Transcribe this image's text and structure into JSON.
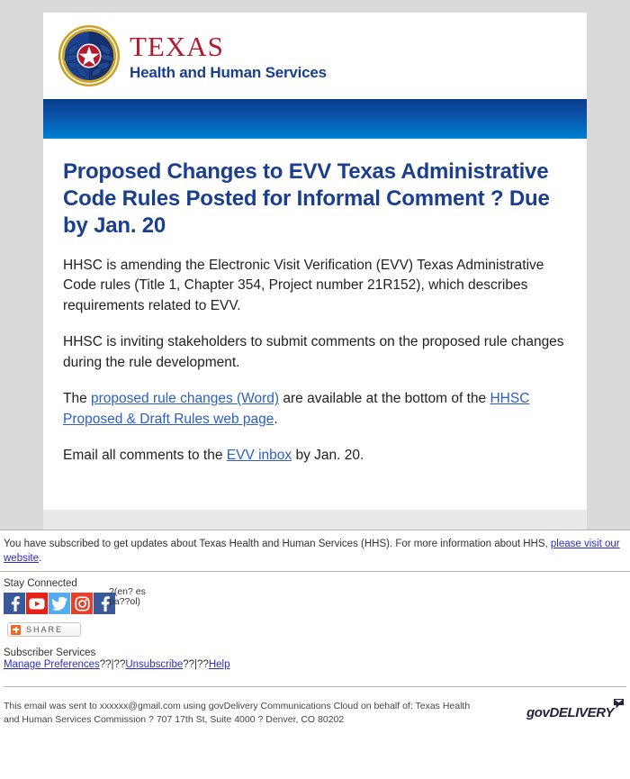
{
  "brand": {
    "seal_icon": "texas-state-seal-icon",
    "name_primary": "TEXAS",
    "name_secondary": "Health and Human Services"
  },
  "email": {
    "title": "Proposed Changes to EVV Texas Administrative Code Rules Posted for Informal Comment ? Due by Jan. 20",
    "paragraph_1": "HHSC is amending the Electronic Visit Verification (EVV) Texas Administrative Code rules (Title 1, Chapter 354, Project number 21R152), which describes requirements related to EVV.",
    "paragraph_2": "HHSC is inviting stakeholders to submit comments on the proposed rule changes during the rule development.",
    "paragraph_3": {
      "lead": "The ",
      "link_1": "proposed rule changes (Word)",
      "middle": " are available at the bottom of the ",
      "link_2": "HHSC Proposed & Draft Rules web page",
      "tail": "."
    },
    "paragraph_4": {
      "lead": "Email all comments to the ",
      "link_1": "EVV inbox",
      "tail": " by Jan. 20."
    }
  },
  "subscription": {
    "notice_lead": "You have subscribed to get updates about Texas Health and Human Services (HHS). For more information about HHS, ",
    "notice_link": "please visit our website",
    "notice_tail": "."
  },
  "stay_connected": {
    "label": "Stay Connected",
    "social": [
      {
        "name": "facebook-icon",
        "platform": "Facebook"
      },
      {
        "name": "youtube-icon",
        "platform": "YouTube"
      },
      {
        "name": "twitter-icon",
        "platform": "Twitter"
      },
      {
        "name": "instagram-icon",
        "platform": "Instagram"
      },
      {
        "name": "facebook-spanish-icon",
        "platform": "Facebook"
      }
    ],
    "language_note": "?(en? espa??ol)",
    "share_button": {
      "label": "SHARE",
      "icon": "share-plus-icon"
    }
  },
  "subscriber_services": {
    "label": "Subscriber Services",
    "link_manage": "Manage Preferences",
    "sep_1": "??|??",
    "link_unsubscribe": "Unsubscribe",
    "sep_2": "??|??",
    "link_help": "Help"
  },
  "legal": {
    "text": "This email was sent to xxxxxx@gmail.com using govDelivery Communications Cloud on behalf of: Texas Health and Human Services Commission ? 707 17th St, Suite 4000 ? Denver, CO 80202",
    "provider_logo": "govDELIVERY",
    "provider_mark": "envelope-mark-icon"
  },
  "colors": {
    "brand_red": "#b01c2e",
    "brand_navy": "#1b3f8f",
    "footer_navy": "#043086",
    "link_blue": "#2c5fc4",
    "page_bg": "#d9d9d9",
    "band_top": "#0a3c8c",
    "band_bottom": "#0384d6"
  }
}
